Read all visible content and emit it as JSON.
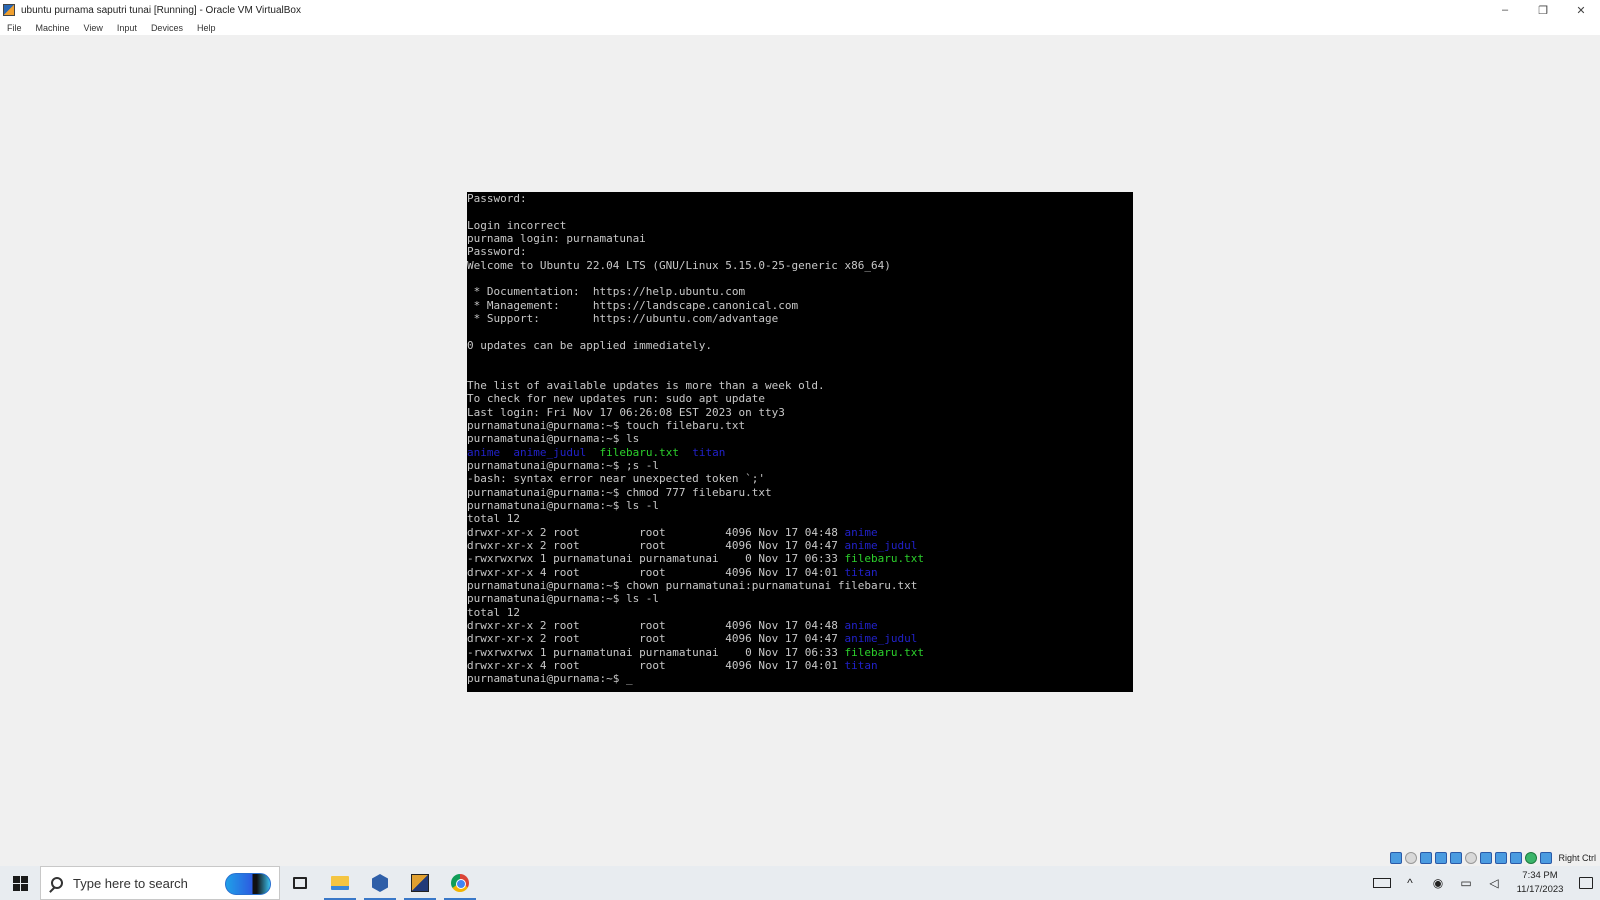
{
  "window": {
    "title": "ubuntu purnama saputri tunai [Running] - Oracle VM VirtualBox",
    "minimize_glyph": "–",
    "maximize_glyph": "❐",
    "close_glyph": "✕"
  },
  "menu": {
    "file": "File",
    "machine": "Machine",
    "view": "View",
    "input": "Input",
    "devices": "Devices",
    "help": "Help"
  },
  "console": {
    "lines": [
      "Password:",
      "",
      "Login incorrect",
      "purnama login: purnamatunai",
      "Password:",
      "Welcome to Ubuntu 22.04 LTS (GNU/Linux 5.15.0-25-generic x86_64)",
      "",
      " * Documentation:  https://help.ubuntu.com",
      " * Management:     https://landscape.canonical.com",
      " * Support:        https://ubuntu.com/advantage",
      "",
      "0 updates can be applied immediately.",
      "",
      "",
      "The list of available updates is more than a week old.",
      "To check for new updates run: sudo apt update",
      "Last login: Fri Nov 17 06:26:08 EST 2023 on tty3",
      "purnamatunai@purnama:~$ touch filebaru.txt",
      "purnamatunai@purnama:~$ ls",
      "__LS1__",
      "purnamatunai@purnama:~$ ;s -l",
      "-bash: syntax error near unexpected token `;'",
      "purnamatunai@purnama:~$ chmod 777 filebaru.txt",
      "purnamatunai@purnama:~$ ls -l",
      "total 12",
      "__L1__",
      "__L2__",
      "__L3__",
      "__L4__",
      "purnamatunai@purnama:~$ chown purnamatunai:purnamatunai filebaru.txt",
      "purnamatunai@purnama:~$ ls -l",
      "total 12",
      "__L5__",
      "__L6__",
      "__L7__",
      "__L8__",
      "purnamatunai@purnama:~$ _"
    ],
    "ls_names": {
      "anime": "anime",
      "anime_judul": "anime_judul",
      "filebaru": "filebaru.txt",
      "titan": "titan"
    },
    "listing1": [
      {
        "prefix": "drwxr-xr-x 2 root         root         4096 Nov 17 04:48 ",
        "name": "anime",
        "color": "blue"
      },
      {
        "prefix": "drwxr-xr-x 2 root         root         4096 Nov 17 04:47 ",
        "name": "anime_judul",
        "color": "blue"
      },
      {
        "prefix": "-rwxrwxrwx 1 purnamatunai purnamatunai    0 Nov 17 06:33 ",
        "name": "filebaru.txt",
        "color": "green"
      },
      {
        "prefix": "drwxr-xr-x 4 root         root         4096 Nov 17 04:01 ",
        "name": "titan",
        "color": "blue"
      }
    ],
    "listing2": [
      {
        "prefix": "drwxr-xr-x 2 root         root         4096 Nov 17 04:48 ",
        "name": "anime",
        "color": "blue"
      },
      {
        "prefix": "drwxr-xr-x 2 root         root         4096 Nov 17 04:47 ",
        "name": "anime_judul",
        "color": "blue"
      },
      {
        "prefix": "-rwxrwxrwx 1 purnamatunai purnamatunai    0 Nov 17 06:33 ",
        "name": "filebaru.txt",
        "color": "green"
      },
      {
        "prefix": "drwxr-xr-x 4 root         root         4096 Nov 17 04:01 ",
        "name": "titan",
        "color": "blue"
      }
    ],
    "colors": {
      "text": "#c8c8c8",
      "blue": "#2121c8",
      "green": "#2cd02c",
      "background": "#000000"
    }
  },
  "vm_status": {
    "host_key": "Right Ctrl"
  },
  "taskbar": {
    "search_placeholder": "Type here to search",
    "time": "7:34 PM",
    "date": "11/17/2023",
    "tray_chevron": "^"
  }
}
